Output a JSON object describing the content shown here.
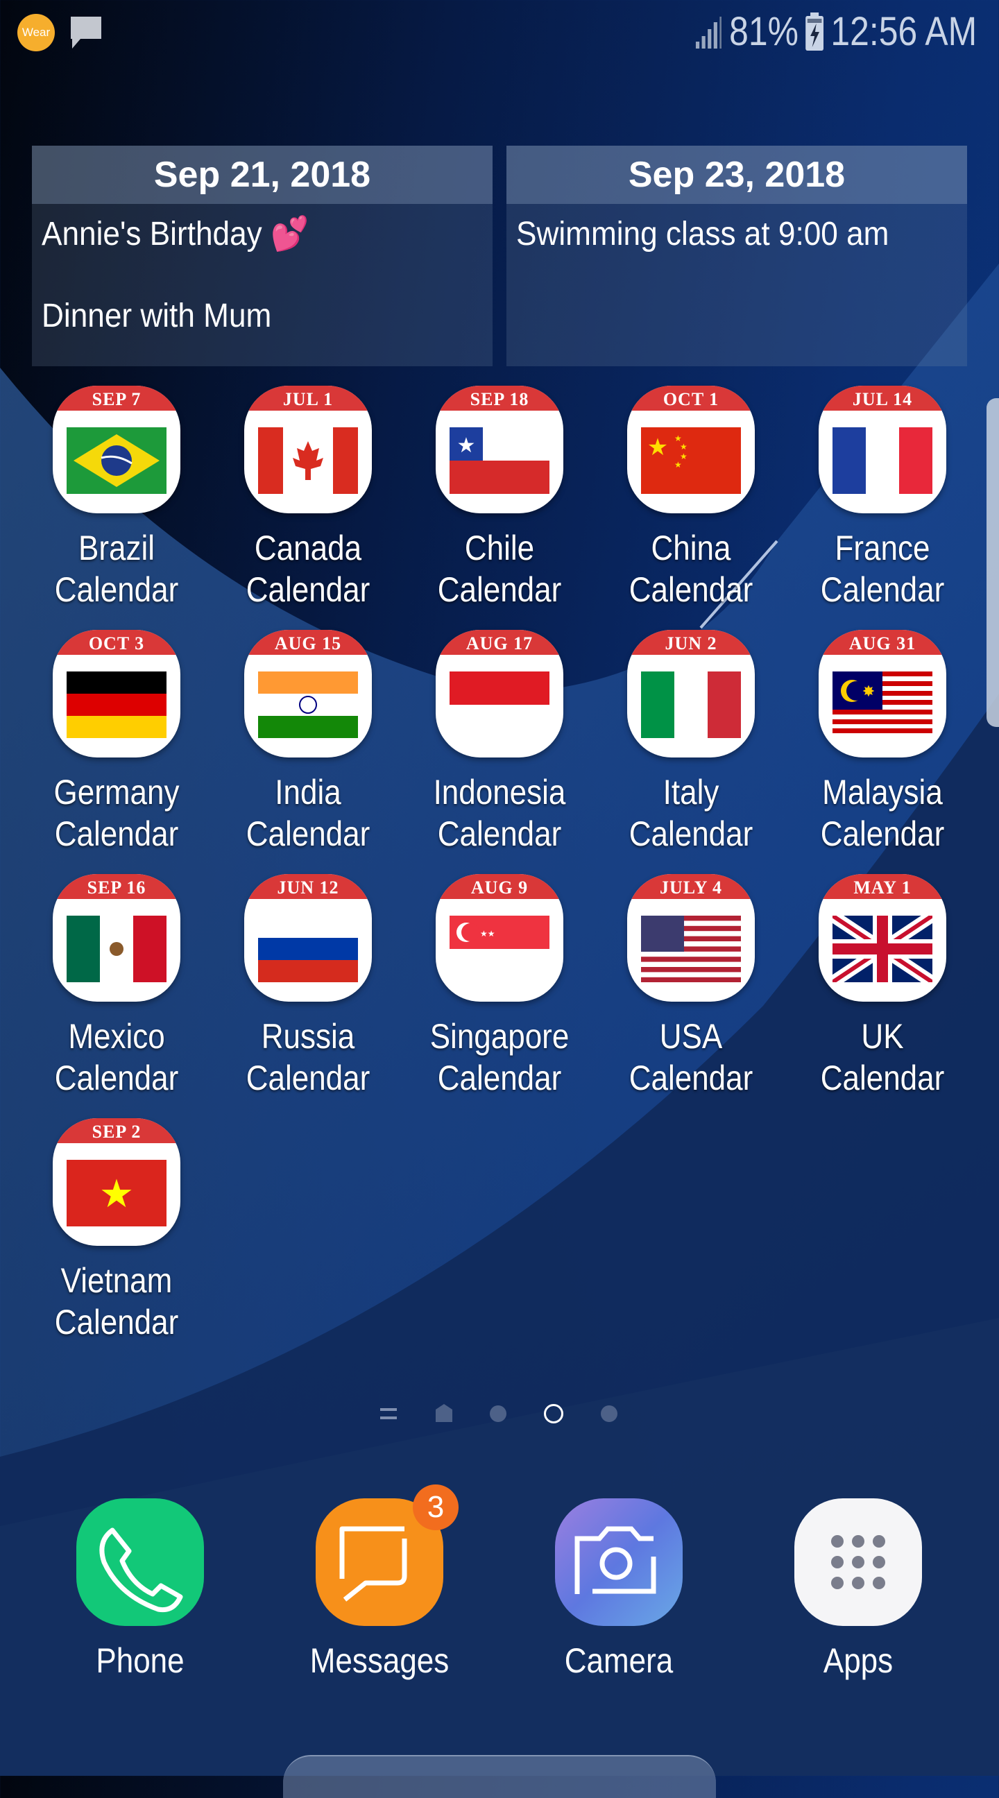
{
  "status_bar": {
    "notification_icons": [
      "wear-app-icon",
      "message-notification-icon"
    ],
    "wear_label": "Wear",
    "signal_icon": "signal-bars-icon",
    "battery_percent": "81%",
    "battery_icon": "battery-charging-icon",
    "time": "12:56 AM"
  },
  "widgets": [
    {
      "date": "Sep 21, 2018",
      "events": [
        "Annie's Birthday 💕",
        "Dinner with Mum"
      ]
    },
    {
      "date": "Sep 23, 2018",
      "events": [
        "Swimming class at 9:00 am"
      ]
    }
  ],
  "apps": [
    {
      "label": "Brazil Calendar",
      "date_tab": "SEP 7",
      "flag": "brazil"
    },
    {
      "label": "Canada Calendar",
      "date_tab": "JUL 1",
      "flag": "canada"
    },
    {
      "label": "Chile Calendar",
      "date_tab": "SEP 18",
      "flag": "chile"
    },
    {
      "label": "China Calendar",
      "date_tab": "OCT 1",
      "flag": "china"
    },
    {
      "label": "France Calendar",
      "date_tab": "JUL 14",
      "flag": "france"
    },
    {
      "label": "Germany Calendar",
      "date_tab": "OCT 3",
      "flag": "germany"
    },
    {
      "label": "India Calendar",
      "date_tab": "AUG 15",
      "flag": "india"
    },
    {
      "label": "Indonesia Calendar",
      "date_tab": "AUG 17",
      "flag": "indonesia"
    },
    {
      "label": "Italy Calendar",
      "date_tab": "JUN 2",
      "flag": "italy"
    },
    {
      "label": "Malaysia Calendar",
      "date_tab": "AUG 31",
      "flag": "malaysia"
    },
    {
      "label": "Mexico Calendar",
      "date_tab": "SEP 16",
      "flag": "mexico"
    },
    {
      "label": "Russia Calendar",
      "date_tab": "JUN 12",
      "flag": "russia"
    },
    {
      "label": "Singapore Calendar",
      "date_tab": "AUG 9",
      "flag": "singapore"
    },
    {
      "label": "USA Calendar",
      "date_tab": "JULY 4",
      "flag": "usa"
    },
    {
      "label": "UK Calendar",
      "date_tab": "MAY 1",
      "flag": "uk"
    },
    {
      "label": "Vietnam Calendar",
      "date_tab": "SEP 2",
      "flag": "vietnam"
    }
  ],
  "page_indicator": {
    "items": [
      "briefing-page",
      "home-page",
      "page-3",
      "page-4",
      "page-5"
    ],
    "current_index": 3
  },
  "dock": [
    {
      "label": "Phone",
      "icon": "phone-icon",
      "color": "#12c878"
    },
    {
      "label": "Messages",
      "icon": "messages-icon",
      "color": "#f7901a",
      "badge": "3"
    },
    {
      "label": "Camera",
      "icon": "camera-icon",
      "color": "#6f87e0"
    },
    {
      "label": "Apps",
      "icon": "apps-grid-icon",
      "color": "#f5f5f7"
    }
  ]
}
